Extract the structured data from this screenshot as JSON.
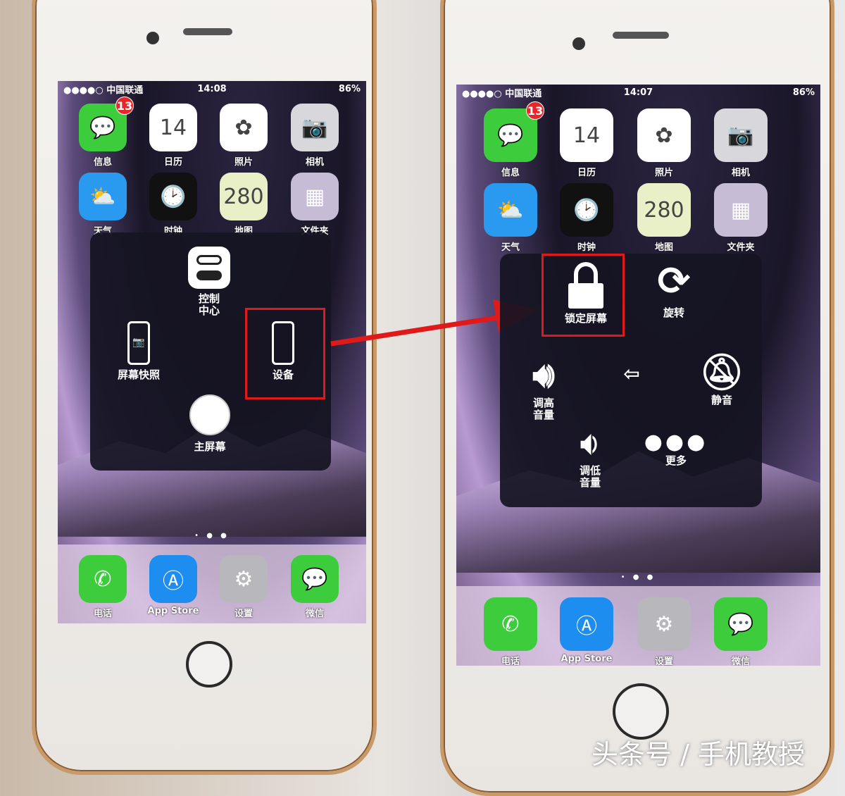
{
  "colors": {
    "highlight": "#e01a1a",
    "badge": "#e8262a"
  },
  "left_phone": {
    "status": {
      "carrier": "●●●●○ 中国联通",
      "time": "14:08",
      "right": "86%"
    },
    "apps": [
      {
        "label": "信息",
        "icon": "messages-icon",
        "color": "#3ccc3c",
        "badge": "13"
      },
      {
        "label": "日历",
        "icon": "calendar-icon",
        "color": "#ffffff",
        "glyph": "14"
      },
      {
        "label": "照片",
        "icon": "photos-icon",
        "color": "#ffffff",
        "glyph": "✿"
      },
      {
        "label": "相机",
        "icon": "camera-icon",
        "color": "#d8d8dc",
        "glyph": "📷"
      },
      {
        "label": "天气",
        "icon": "weather-icon",
        "color": "#2a9af0",
        "glyph": "⛅"
      },
      {
        "label": "时钟",
        "icon": "clock-icon",
        "color": "#111111",
        "glyph": "🕑"
      },
      {
        "label": "地图",
        "icon": "maps-icon",
        "color": "#e9f0c8",
        "glyph": "280"
      },
      {
        "label": "文件夹",
        "icon": "folder-icon",
        "color": "#c7bcd6",
        "glyph": "▦"
      }
    ],
    "dock": [
      {
        "label": "电话",
        "icon": "phone-icon",
        "color": "#3ccc3c",
        "glyph": "✆"
      },
      {
        "label": "App Store",
        "icon": "app-store-icon",
        "color": "#1e8df0",
        "glyph": "Ⓐ"
      },
      {
        "label": "设置",
        "icon": "settings-icon",
        "color": "#b8b8bc",
        "glyph": "⚙"
      },
      {
        "label": "微信",
        "icon": "wechat-icon",
        "color": "#3ccc3c",
        "glyph": "💬"
      }
    ],
    "menu": {
      "control_center": "控制\n中心",
      "screenshot": "屏幕快照",
      "device": "设备",
      "home": "主屏幕"
    }
  },
  "right_phone": {
    "status": {
      "carrier": "●●●●○ 中国联通",
      "time": "14:07",
      "right": "86%"
    },
    "apps": [
      {
        "label": "信息",
        "icon": "messages-icon",
        "color": "#3ccc3c",
        "badge": "13"
      },
      {
        "label": "日历",
        "icon": "calendar-icon",
        "color": "#ffffff",
        "glyph": "14"
      },
      {
        "label": "照片",
        "icon": "photos-icon",
        "color": "#ffffff",
        "glyph": "✿"
      },
      {
        "label": "相机",
        "icon": "camera-icon",
        "color": "#d8d8dc",
        "glyph": "📷"
      },
      {
        "label": "天气",
        "icon": "weather-icon",
        "color": "#2a9af0",
        "glyph": "⛅"
      },
      {
        "label": "时钟",
        "icon": "clock-icon",
        "color": "#111111",
        "glyph": "🕑"
      },
      {
        "label": "地图",
        "icon": "maps-icon",
        "color": "#e9f0c8",
        "glyph": "280"
      },
      {
        "label": "文件夹",
        "icon": "folder-icon",
        "color": "#c7bcd6",
        "glyph": "▦"
      }
    ],
    "dock": [
      {
        "label": "电话",
        "icon": "phone-icon",
        "color": "#3ccc3c",
        "glyph": "✆"
      },
      {
        "label": "App Store",
        "icon": "app-store-icon",
        "color": "#1e8df0",
        "glyph": "Ⓐ"
      },
      {
        "label": "设置",
        "icon": "settings-icon",
        "color": "#b8b8bc",
        "glyph": "⚙"
      },
      {
        "label": "微信",
        "icon": "wechat-icon",
        "color": "#3ccc3c",
        "glyph": "💬"
      }
    ],
    "menu": {
      "lock_screen": "锁定屏幕",
      "rotate": "旋转",
      "volume_up": "调高\n音量",
      "back": "⇦",
      "mute": "静音",
      "volume_down": "调低\n音量",
      "more": "更多"
    }
  },
  "watermark": "头条号 / 手机教授"
}
